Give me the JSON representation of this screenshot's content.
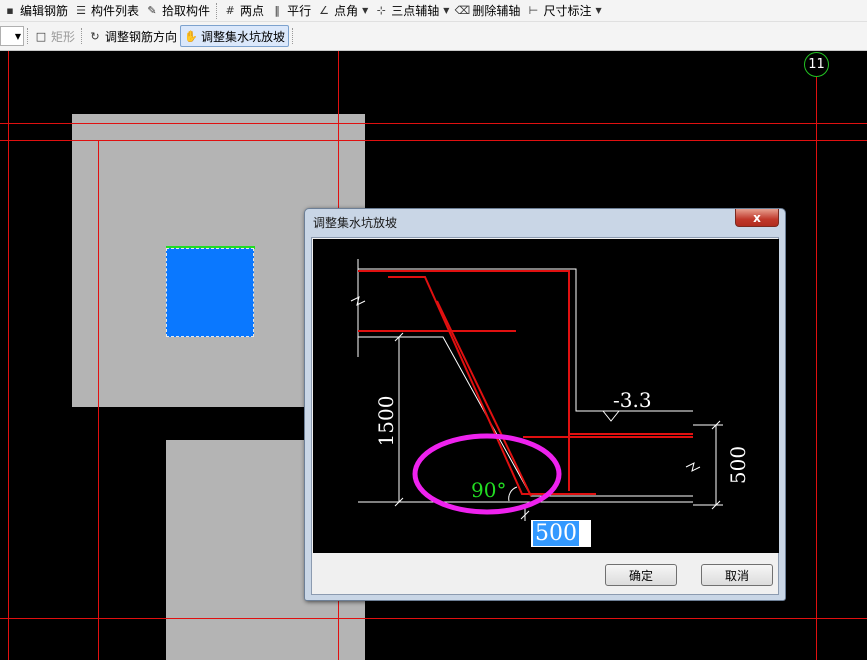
{
  "toolbar1": {
    "items": [
      "编辑钢筋",
      "构件列表",
      "拾取构件",
      "两点",
      "平行",
      "点角",
      "三点辅轴",
      "删除辅轴",
      "尺寸标注"
    ]
  },
  "toolbar2": {
    "rect_label": "矩形",
    "rebar_dir_label": "调整钢筋方向",
    "slope_label": "调整集水坑放坡"
  },
  "canvas": {
    "axis_label": "11",
    "colors": {
      "grid_line": "#e01010",
      "slab": "#b4b4b4",
      "pit": "#0a78ff",
      "pit_edge": "#22dd22",
      "axis_circle": "#22c322"
    }
  },
  "dialog": {
    "title": "调整集水坑放坡",
    "close": "x",
    "figure": {
      "elevation": "-3.3",
      "depth_label": "1500",
      "thickness_label": "500",
      "angle_label": "90°",
      "colors": {
        "rebar": "#e01010",
        "highlight": "#ee22ee",
        "angle": "#22dd22"
      }
    },
    "input_value": "500",
    "ok_label": "确定",
    "cancel_label": "取消"
  }
}
